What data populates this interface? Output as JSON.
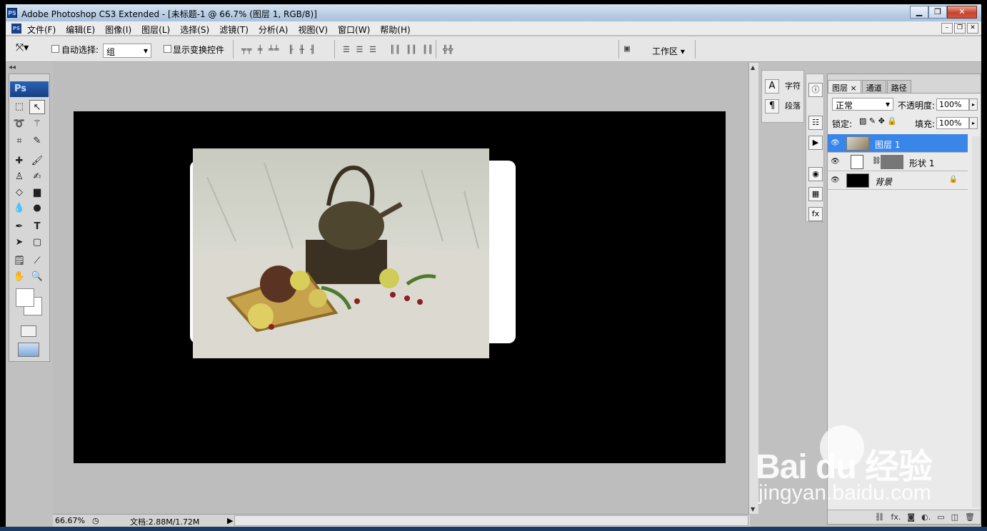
{
  "window": {
    "app_icon": "PS",
    "title": "Adobe Photoshop CS3 Extended - [未标题-1 @ 66.7% (图层 1, RGB/8)]",
    "controls": [
      "minimize",
      "maximize",
      "close"
    ]
  },
  "menubar": {
    "items": [
      "文件(F)",
      "编辑(E)",
      "图像(I)",
      "图层(L)",
      "选择(S)",
      "滤镜(T)",
      "分析(A)",
      "视图(V)",
      "窗口(W)",
      "帮助(H)"
    ]
  },
  "options_bar": {
    "auto_select_label": "自动选择:",
    "auto_select_checked": false,
    "auto_select_value": "组",
    "show_transform_label": "显示变换控件",
    "show_transform_checked": false,
    "workspace_label": "工作区 ▾"
  },
  "toolbox": {
    "logo": "Ps",
    "active_tool": "move-tool",
    "foreground_color": "#ffffff",
    "background_color": "#ffffff"
  },
  "document": {
    "zoom": "66.67%",
    "doc_info": "文档:2.88M/1.72M",
    "background_color": "#000000",
    "shape_color": "#ffffff"
  },
  "char_panel": {
    "items": [
      {
        "icon": "A",
        "label": "字符"
      },
      {
        "icon": "¶",
        "label": "段落"
      }
    ]
  },
  "layers_panel": {
    "tabs": [
      "图层 ×",
      "通道",
      "路径"
    ],
    "blend_mode": "正常",
    "opacity_label": "不透明度:",
    "opacity": "100%",
    "lock_label": "锁定:",
    "fill_label": "填充:",
    "fill": "100%",
    "layers": [
      {
        "name": "图层 1",
        "selected": true
      },
      {
        "name": "形状 1",
        "selected": false
      },
      {
        "name": "背景",
        "selected": false,
        "locked": true
      }
    ],
    "footer_icons": [
      "link-icon",
      "fx-icon",
      "mask-icon",
      "adjustment-icon",
      "group-icon",
      "new-layer-icon",
      "trash-icon"
    ]
  },
  "watermark": {
    "brand": "Bai du 经验",
    "url": "jingyan.baidu.com"
  }
}
